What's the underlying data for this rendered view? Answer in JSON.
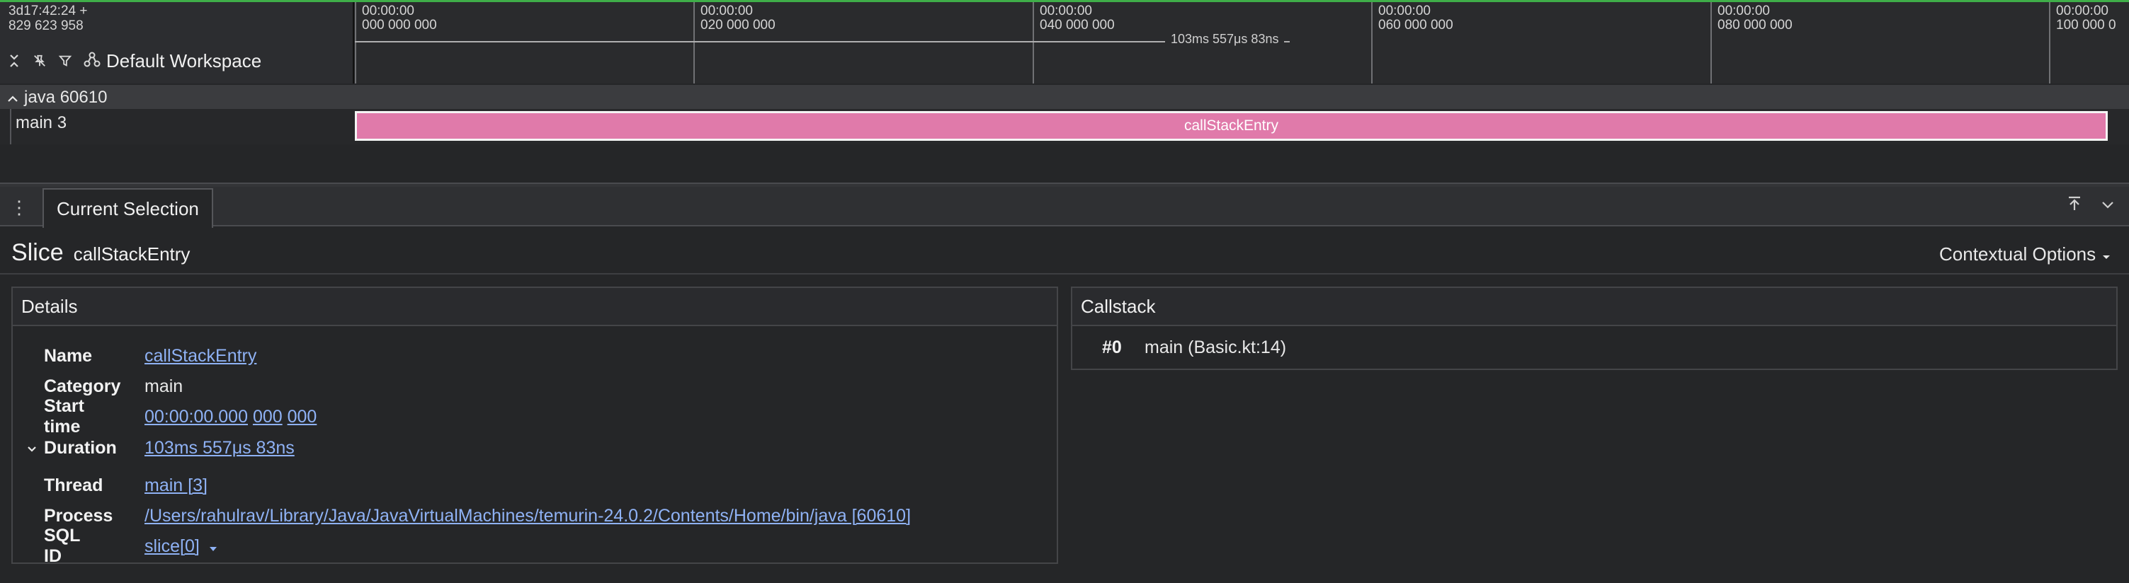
{
  "timeline": {
    "origin_line1": "3d17:42:24 +",
    "origin_line2": "829 623 958",
    "ticks": [
      {
        "line1": "00:00:00",
        "line2": "000 000 000"
      },
      {
        "line1": "00:00:00",
        "line2": "020 000 000"
      },
      {
        "line1": "00:00:00",
        "line2": "040 000 000"
      },
      {
        "line1": "00:00:00",
        "line2": "060 000 000"
      },
      {
        "line1": "00:00:00",
        "line2": "080 000 000"
      },
      {
        "line1": "00:00:00",
        "line2": "100 000 0"
      }
    ],
    "span_label": "103ms 557μs 83ns",
    "workspace_label": "Default Workspace"
  },
  "tracks": {
    "group_label": "java 60610",
    "thread_label": "main 3",
    "slice_label": "callStackEntry",
    "slice_color": "#e07aaa"
  },
  "panel": {
    "tab_label": "Current Selection",
    "title_kind": "Slice",
    "title_name": "callStackEntry",
    "contextual_label": "Contextual Options",
    "details": {
      "header": "Details",
      "rows": [
        {
          "key": "Name",
          "value": "callStackEntry"
        },
        {
          "key": "Category",
          "value": "main"
        },
        {
          "key": "Start time",
          "value_a": "00:00:00.000",
          "value_b": "000",
          "value_c": "000"
        },
        {
          "key": "Duration",
          "value": "103ms 557μs 83ns"
        },
        {
          "key": "Thread",
          "value": "main [3]"
        },
        {
          "key": "Process",
          "value": "/Users/rahulrav/Library/Java/JavaVirtualMachines/temurin-24.0.2/Contents/Home/bin/java [60610]"
        },
        {
          "key": "SQL ID",
          "value": "slice[0]"
        }
      ]
    },
    "callstack": {
      "header": "Callstack",
      "frames": [
        {
          "index": "#0",
          "value": "main (Basic.kt:14)"
        }
      ]
    }
  },
  "colors": {
    "accent": "#3fae49",
    "link": "#8fb2f5",
    "background": "#252628"
  },
  "icons": [
    "collapse-icon",
    "unpin-icon",
    "filter-icon",
    "workspace-icon",
    "kebab-icon",
    "maximize-icon",
    "chevron-down-icon"
  ]
}
